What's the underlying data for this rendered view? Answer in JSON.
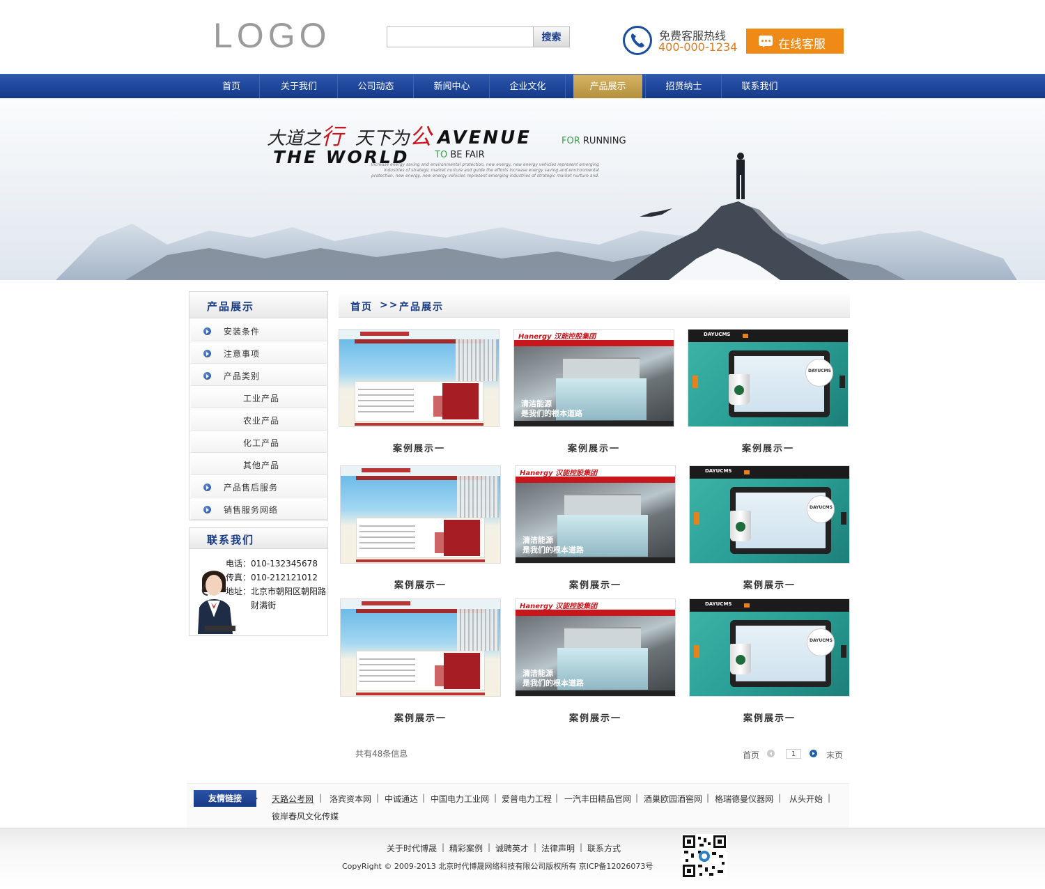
{
  "header": {
    "logo_text": "LOGO",
    "search_placeholder": "",
    "search_button": "搜索",
    "hotline_label": "免费客服热线",
    "hotline_number": "400-000-1234",
    "online_service": "在线客服"
  },
  "nav": {
    "items": [
      "首页",
      "关于我们",
      "公司动态",
      "新闻中心",
      "企业文化",
      "产品展示",
      "招贤纳士",
      "联系我们"
    ],
    "active_index": 5
  },
  "banner": {
    "cn_part1": "大道之",
    "cn_red1": "行",
    "cn_part2": "天下为",
    "cn_red2": "公",
    "en_line1": "AVENUE",
    "en_for": "FOR",
    "en_running": "RUNNING",
    "en_line2": "THE WORLD",
    "en_to": "TO",
    "en_befair": "BE FAIR",
    "small_text": "Increase energy saving and environmental protection, new energy, new energy vehicles represent emerging industries of strategic market nurture and guide the efforts increase energy saving and environmental protection, new energy, new energy vehicles represent emerging industries of strategic market nurture and."
  },
  "sidebar": {
    "title": "产品展示",
    "items": [
      {
        "label": "安装条件",
        "sub": false
      },
      {
        "label": "注意事项",
        "sub": false
      },
      {
        "label": "产品类别",
        "sub": false
      },
      {
        "label": "工业产品",
        "sub": true
      },
      {
        "label": "农业产品",
        "sub": true
      },
      {
        "label": "化工产品",
        "sub": true
      },
      {
        "label": "其他产品",
        "sub": true
      },
      {
        "label": "产品售后服务",
        "sub": false
      },
      {
        "label": "销售服务网络",
        "sub": false
      }
    ],
    "contact_title": "联系我们",
    "phone": "电话：010-132345678",
    "fax": "传真：010-212121012",
    "address1": "地址：北京市朝阳区朝阳路",
    "address2": "财满街"
  },
  "breadcrumb": {
    "home": "首页",
    "sep": ">>",
    "current": "产品展示"
  },
  "products": {
    "captions": [
      "案例展示一",
      "案例展示一",
      "案例展示一",
      "案例展示一",
      "案例展示一",
      "案例展示一",
      "案例展示一",
      "案例展示一",
      "案例展示一"
    ],
    "thumb_b_brand": "Hanergy 汉能控股集团",
    "thumb_b_line1": "清洁能源",
    "thumb_b_line2": "是我们的根本道路",
    "thumb_c_brand": "DAYUCMS",
    "thumb_c_badge": "DAYUCMS"
  },
  "pagination": {
    "total": "共有48条信息",
    "first": "首页",
    "current_page": "1",
    "last": "末页"
  },
  "links": {
    "title": "友情链接",
    "items": [
      "天路公考网",
      "洛宾资本网",
      "中诚通达",
      "中国电力工业网",
      "爱普电力工程",
      "一汽丰田精品官网",
      "酒巢欧园酒窖网",
      "格瑞德曼仪器网",
      "从头开始",
      "彼岸春风文化传媒"
    ]
  },
  "footer": {
    "links": [
      "关于时代博晟",
      "精彩案例",
      "诚聘英才",
      "法律声明",
      "联系方式"
    ],
    "copyright": "CopyRight © 2009-2013  北京时代博晟网络科技有限公司版权所有  京ICP备12026073号"
  },
  "colors": {
    "nav_blue": "#1f479b",
    "accent_orange": "#f08a16",
    "active_gold": "#c8a24d",
    "title_blue": "#163a86"
  }
}
